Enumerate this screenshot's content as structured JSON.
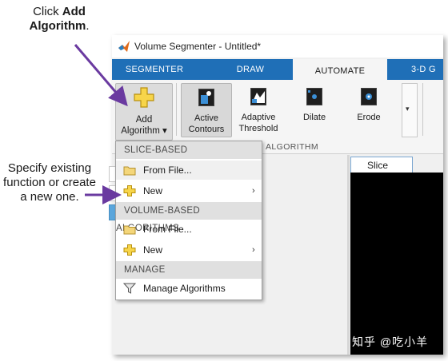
{
  "callouts": {
    "top_prefix": "Click ",
    "top_bold": "Add Algorithm",
    "top_suffix": ".",
    "side": "Specify existing function or create a new one."
  },
  "window": {
    "title": "Volume Segmenter - Untitled*"
  },
  "tabs": [
    {
      "label": "SEGMENTER",
      "active": false
    },
    {
      "label": "DRAW",
      "active": false
    },
    {
      "label": "AUTOMATE",
      "active": true
    },
    {
      "label": "3-D G",
      "active": false
    }
  ],
  "ribbon": {
    "add_algorithm": {
      "line1": "Add",
      "line2": "Algorithm ▾"
    },
    "algorithms": [
      {
        "line1": "Active",
        "line2": "Contours"
      },
      {
        "line1": "Adaptive",
        "line2": "Threshold"
      },
      {
        "line1": "Dilate",
        "line2": ""
      },
      {
        "line1": "Erode",
        "line2": ""
      }
    ],
    "gallery_arrow": "▾",
    "section_label": "ALGORITHM"
  },
  "menu": {
    "slice_header": "SLICE-BASED",
    "slice_from_file": "From File...",
    "slice_new": "New",
    "volume_header": "VOLUME-BASED ALGORITHMS",
    "volume_from_file": "From File...",
    "volume_new": "New",
    "manage_header": "MANAGE",
    "manage_item": "Manage Algorithms",
    "submenu_arrow": "›"
  },
  "view": {
    "slice_tab": "Slice"
  },
  "colors": {
    "label1": "#1a72c0",
    "label2": "#d95319",
    "label3": "#edb120",
    "tabstrip": "#1f6fb7",
    "callout_arrow": "#6a3aa0"
  },
  "watermark": "知乎 @吃小羊"
}
